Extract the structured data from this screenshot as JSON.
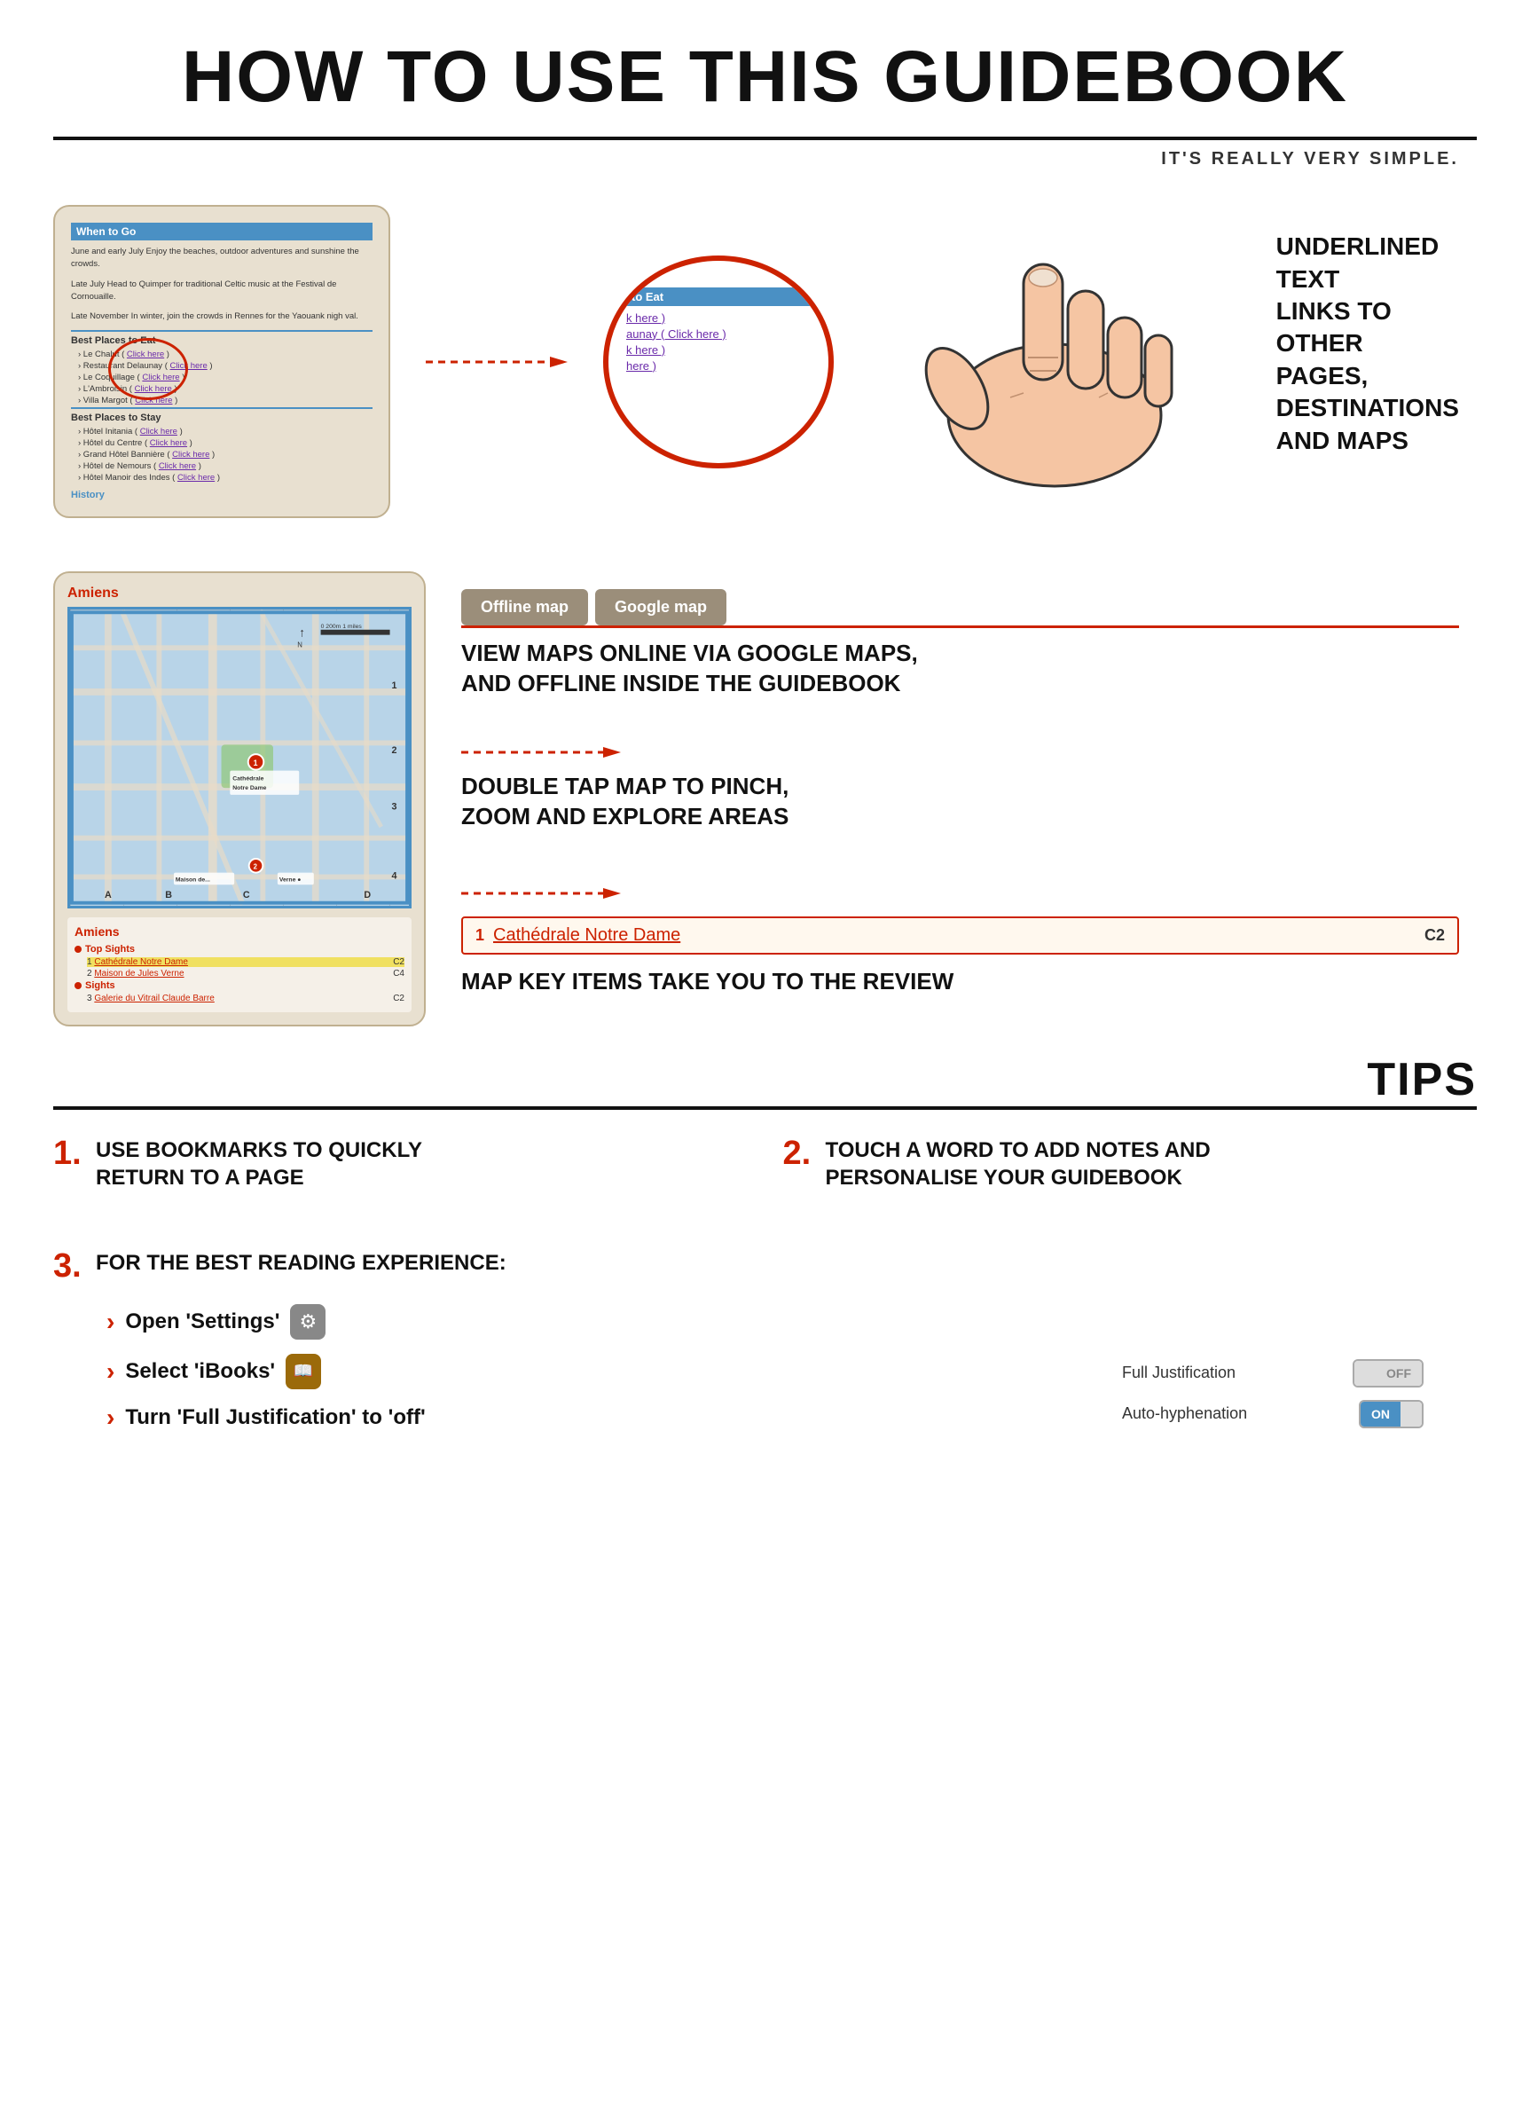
{
  "header": {
    "title": "HOW TO USE THIS GUIDEBOOK",
    "subtitle": "IT'S REALLY VERY SIMPLE."
  },
  "section1": {
    "guidebook": {
      "when_to_go_header": "When to Go",
      "when_body1": "June and early July Enjoy the beaches, outdoor adventures and sunshine the crowds.",
      "when_body2": "Late July Head to Quimper for traditional Celtic music at the Festival de Cornouaille.",
      "when_body3": "Late November In winter, join the crowds in Rennes for the Yaouank nigh val.",
      "best_eat_header": "Best Places to Eat",
      "eat_items": [
        "› Le Chalut ( Click here )",
        "› Restaurant Delaunay ( Click here )",
        "› Le Coquillage ( Click here )",
        "› L'Ambroisin ( Click here )",
        "› Villa Margot ( Click here )"
      ],
      "best_stay_header": "Best Places to Stay",
      "stay_items": [
        "› Hôtel Initania ( Click here )",
        "› Hôtel du Centre ( Click here )",
        "› Grand Hôtel Bannière ( Click here )",
        "› Hôtel de Nemours ( Click here )",
        "› Hôtel Manoir des Indes ( Click here )"
      ],
      "history_link": "History"
    },
    "zoom_panel": {
      "header": "to Eat",
      "items": [
        "k here )",
        "aunay ( Click here )",
        "k here )",
        "here )"
      ]
    },
    "explanation": {
      "text": "UNDERLINED TEXT\nLINKS TO OTHER PAGES,\nDESTINATIONS AND MAPS"
    }
  },
  "section2": {
    "map": {
      "city": "Amiens",
      "grid_cols": [
        "A",
        "B",
        "C",
        "D"
      ],
      "grid_rows": [
        "1",
        "2",
        "3",
        "4"
      ],
      "key_city": "Amiens",
      "top_sights_header": "Top Sights",
      "top_sights": [
        {
          "num": "1",
          "name": "Cathédrale Notre Dame",
          "coord": "C2"
        },
        {
          "num": "2",
          "name": "Maison de Jules Verne",
          "coord": "C4"
        }
      ],
      "sights_header": "Sights",
      "sights": [
        {
          "num": "3",
          "name": "Galerie du Vitrail Claude Barre",
          "coord": "C2"
        }
      ]
    },
    "buttons": {
      "offline": "Offline map",
      "google": "Google map"
    },
    "map_description": "VIEW MAPS ONLINE VIA GOOGLE MAPS,\nAND OFFLINE INSIDE THE GUIDEBOOK",
    "zoom_description": "DOUBLE TAP MAP TO PINCH,\nZOOM AND EXPLORE AREAS",
    "callout": {
      "num": "1",
      "name": "Cathédrale Notre Dame",
      "coord": "C2"
    },
    "review_description": "MAP KEY ITEMS TAKE YOU TO THE REVIEW"
  },
  "tips": {
    "label": "TIPS",
    "items": [
      {
        "number": "1.",
        "text": "USE BOOKMARKS TO QUICKLY\nRETURN TO A PAGE"
      },
      {
        "number": "2.",
        "text": "TOUCH A WORD TO ADD NOTES AND\nPERSONALISE YOUR GUIDEBOOK"
      },
      {
        "number": "3.",
        "text": "FOR THE BEST READING EXPERIENCE:"
      }
    ],
    "tip3_bullets": [
      {
        "text": "Open 'Settings'",
        "icon": "⚙"
      },
      {
        "text": "Select 'iBooks'",
        "icon": "📖"
      },
      {
        "text": "Turn 'Full Justification' to 'off'",
        "icon": ""
      }
    ],
    "toggles": [
      {
        "label": "Full Justification",
        "state": "off"
      },
      {
        "label": "Auto-hyphenation",
        "state": "on"
      }
    ]
  }
}
